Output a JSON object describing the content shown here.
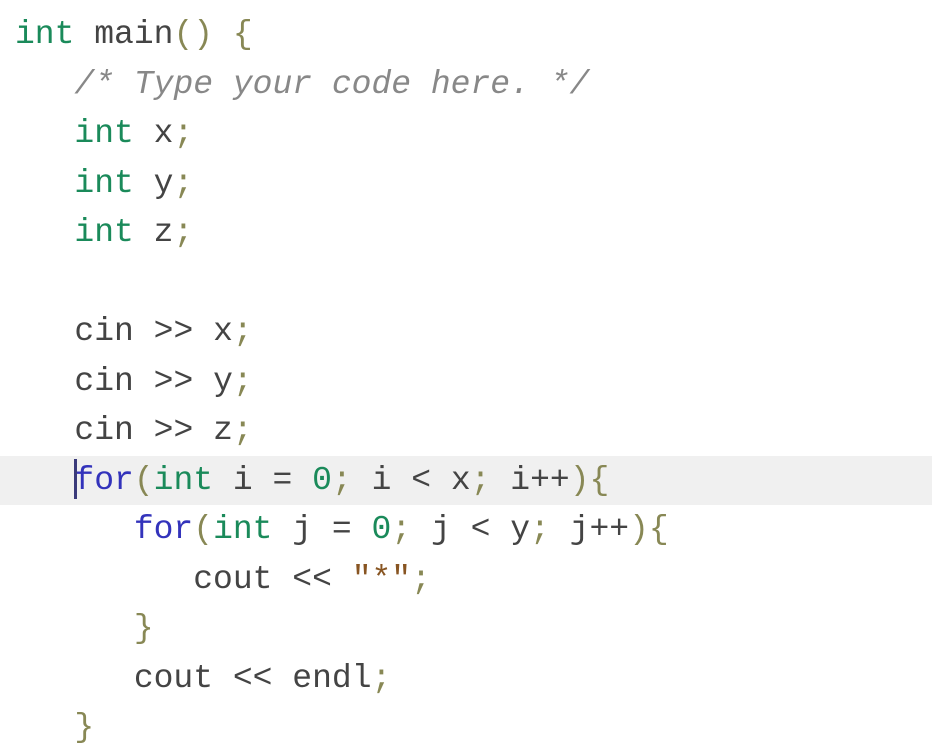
{
  "code": {
    "line1": {
      "kw_int": "int",
      "sp1": " ",
      "main": "main",
      "lparen": "(",
      "rparen": ")",
      "sp2": " ",
      "brace": "{"
    },
    "line2": {
      "indent": "   ",
      "comment": "/* Type your code here. */"
    },
    "line3": {
      "indent": "   ",
      "kw_int": "int",
      "sp": " ",
      "var": "x",
      "semi": ";"
    },
    "line4": {
      "indent": "   ",
      "kw_int": "int",
      "sp": " ",
      "var": "y",
      "semi": ";"
    },
    "line5": {
      "indent": "   ",
      "kw_int": "int",
      "sp": " ",
      "var": "z",
      "semi": ";"
    },
    "line6": {
      "blank": "   "
    },
    "line7": {
      "indent": "   ",
      "cin": "cin",
      "sp1": " ",
      "op": ">>",
      "sp2": " ",
      "var": "x",
      "semi": ";"
    },
    "line8": {
      "indent": "   ",
      "cin": "cin",
      "sp1": " ",
      "op": ">>",
      "sp2": " ",
      "var": "y",
      "semi": ";"
    },
    "line9": {
      "indent": "   ",
      "cin": "cin",
      "sp1": " ",
      "op": ">>",
      "sp2": " ",
      "var": "z",
      "semi": ";"
    },
    "line10": {
      "indent": "   ",
      "kw_for": "for",
      "lp": "(",
      "kw_int": "int",
      "sp1": " ",
      "var_i": "i",
      "sp2": " ",
      "eq": "=",
      "sp3": " ",
      "zero": "0",
      "semi1": ";",
      "sp4": " ",
      "var_i2": "i",
      "sp5": " ",
      "lt": "<",
      "sp6": " ",
      "var_x": "x",
      "semi2": ";",
      "sp7": " ",
      "var_i3": "i",
      "inc": "++",
      "rp": ")",
      "brace": "{"
    },
    "line11": {
      "indent": "      ",
      "kw_for": "for",
      "lp": "(",
      "kw_int": "int",
      "sp1": " ",
      "var_j": "j",
      "sp2": " ",
      "eq": "=",
      "sp3": " ",
      "zero": "0",
      "semi1": ";",
      "sp4": " ",
      "var_j2": "j",
      "sp5": " ",
      "lt": "<",
      "sp6": " ",
      "var_y": "y",
      "semi2": ";",
      "sp7": " ",
      "var_j3": "j",
      "inc": "++",
      "rp": ")",
      "brace": "{"
    },
    "line12": {
      "indent": "         ",
      "cout": "cout",
      "sp1": " ",
      "op": "<<",
      "sp2": " ",
      "str": "\"*\"",
      "semi": ";"
    },
    "line13": {
      "indent": "      ",
      "brace": "}"
    },
    "line14": {
      "indent": "      ",
      "cout": "cout",
      "sp1": " ",
      "op": "<<",
      "sp2": " ",
      "endl": "endl",
      "semi": ";"
    },
    "line15": {
      "indent": "   ",
      "brace": "}"
    }
  }
}
